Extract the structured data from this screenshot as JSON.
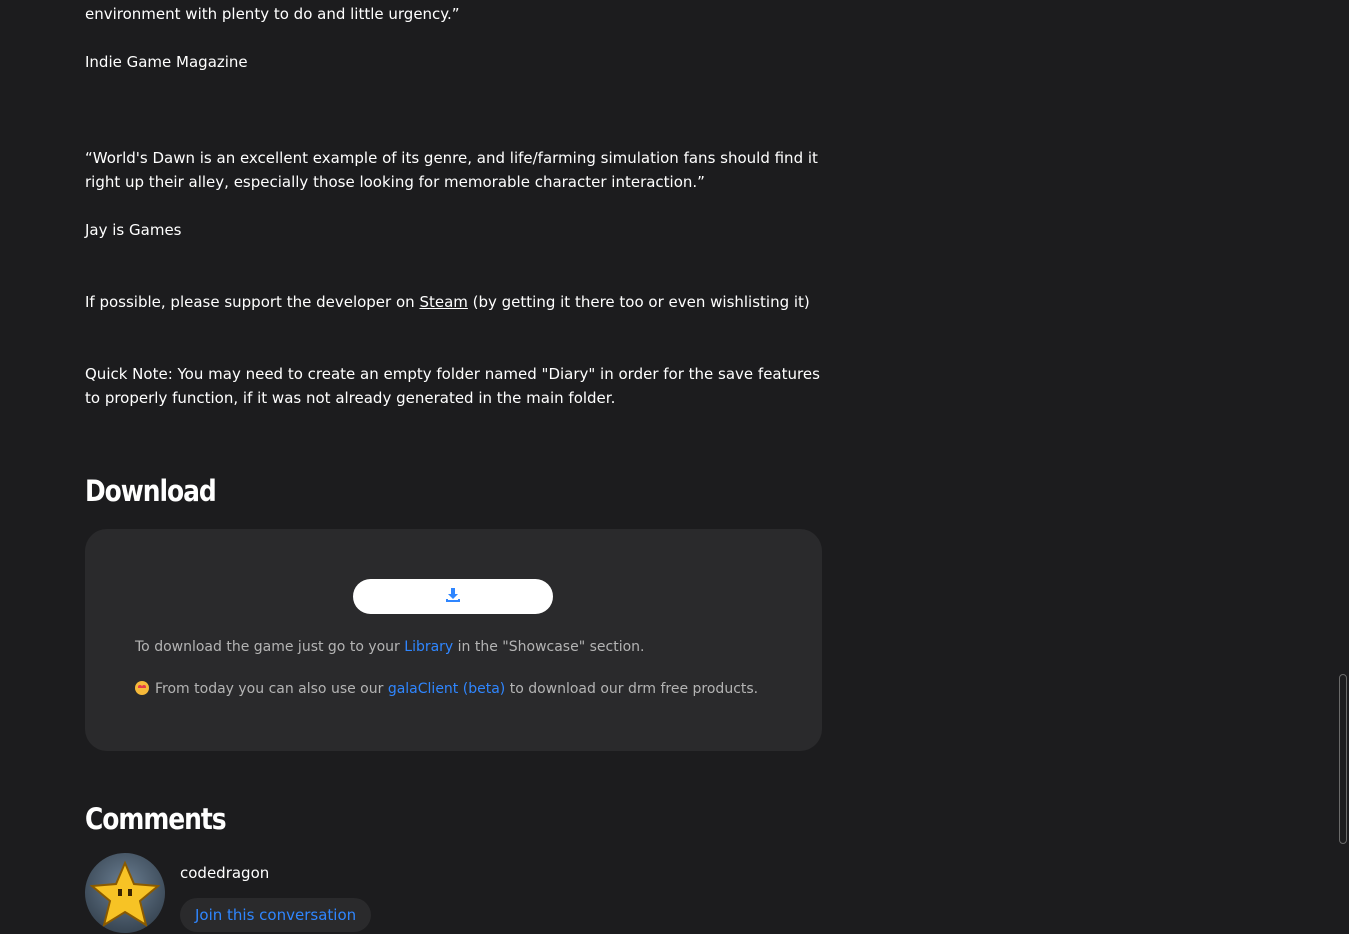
{
  "quotes": {
    "line_top": "environment with plenty to do and little urgency.”",
    "source_1": "Indie Game Magazine",
    "quote_2_line_1": "“World's Dawn is an excellent example of its genre, and life/farming simulation fans should find it",
    "quote_2_line_2": "right up their alley, especially those looking for memorable character interaction.”",
    "source_2": "Jay is Games"
  },
  "support": {
    "before": "If possible, please support the developer on ",
    "link": "Steam",
    "after": " (by getting it there too or even wishlisting it)"
  },
  "note": {
    "line_1": "Quick Note: You may need to create an empty folder named \"Diary\" in order for the save features",
    "line_2": "to properly function, if it was not already generated in the main folder."
  },
  "download": {
    "heading": "Download",
    "button_icon": "download-icon",
    "note_1_before": "To download the game just go to your ",
    "note_1_link": "Library",
    "note_1_after": " in the \"Showcase\" section.",
    "note_2_emoji": "star-struck-emoji",
    "note_2_before": "From today you can also use our ",
    "note_2_link": "galaClient (beta)",
    "note_2_after": " to download our drm free products."
  },
  "comments": {
    "heading": "Comments",
    "username": "codedragon",
    "join_label": "Join this conversation",
    "avatar_icon": "star-avatar-icon"
  },
  "colors": {
    "background": "#1c1c1e",
    "panel": "#2a2a2c",
    "link_blue": "#2f86ff",
    "muted_text": "#b4b4b4"
  }
}
